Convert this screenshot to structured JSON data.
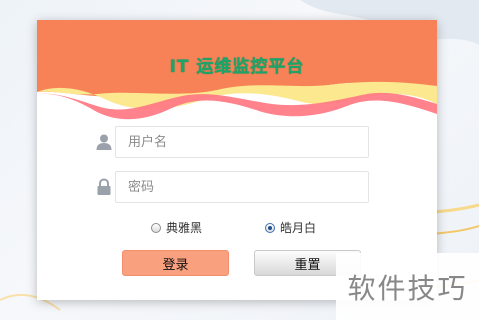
{
  "header": {
    "title": "IT 运维监控平台"
  },
  "form": {
    "username_placeholder": "用户名",
    "password_placeholder": "密码"
  },
  "themes": [
    {
      "label": "典雅黑",
      "selected": false
    },
    {
      "label": "皓月白",
      "selected": true
    }
  ],
  "buttons": {
    "login": "登录",
    "reset": "重置"
  },
  "watermark": "软件技巧",
  "colors": {
    "header_orange": "#f78257",
    "wave_pink": "#ff7b86",
    "wave_yellow": "#fbe88f",
    "title_green": "#1aa56a",
    "login_button": "#f9a07f",
    "icon_gray": "#9aa1ab"
  },
  "icons": {
    "username": "user-icon",
    "password": "lock-icon"
  }
}
